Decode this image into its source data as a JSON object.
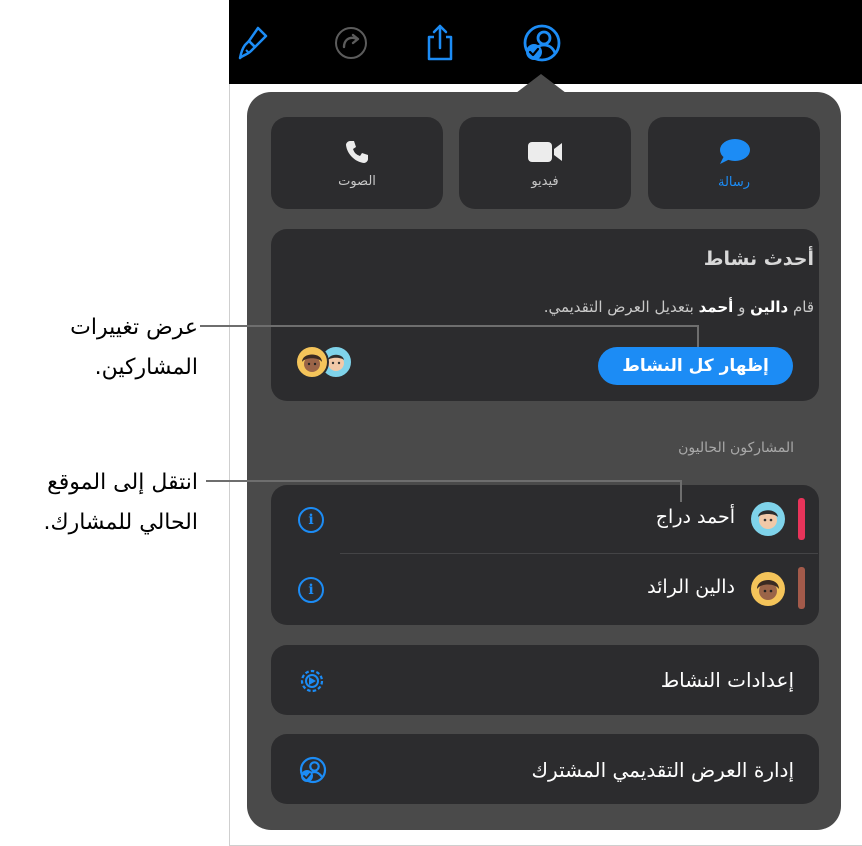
{
  "toolbar": {
    "icons": [
      "paintbrush-icon",
      "redo-icon",
      "share-icon",
      "collaboration-icon"
    ]
  },
  "communication": {
    "message_label": "رسالة",
    "video_label": "فيديو",
    "audio_label": "الصوت"
  },
  "activity": {
    "title": "أحدث نشاط",
    "text_prefix": "قام",
    "person_one": "دالين",
    "conjunction": "و",
    "person_two": "أحمد",
    "text_suffix": "بتعديل العرض التقديمي.",
    "show_all_label": "إظهار كل النشاط"
  },
  "participants": {
    "section_label": "المشاركون الحاليون",
    "items": [
      {
        "name": "أحمد دراج",
        "color": "#e8345a"
      },
      {
        "name": "دالين الرائد",
        "color": "#a35a4a"
      }
    ]
  },
  "settings": {
    "activity_settings_label": "إعدادات النشاط",
    "manage_shared_label": "إدارة العرض التقديمي المشترك"
  },
  "callouts": {
    "first_line1": "عرض تغييرات",
    "first_line2": "المشاركين.",
    "second_line1": "انتقل إلى الموقع",
    "second_line2": "الحالي للمشارك."
  },
  "colors": {
    "accent": "#1c8cf5",
    "popover": "#4a4a4a",
    "card": "#2c2c2e"
  }
}
